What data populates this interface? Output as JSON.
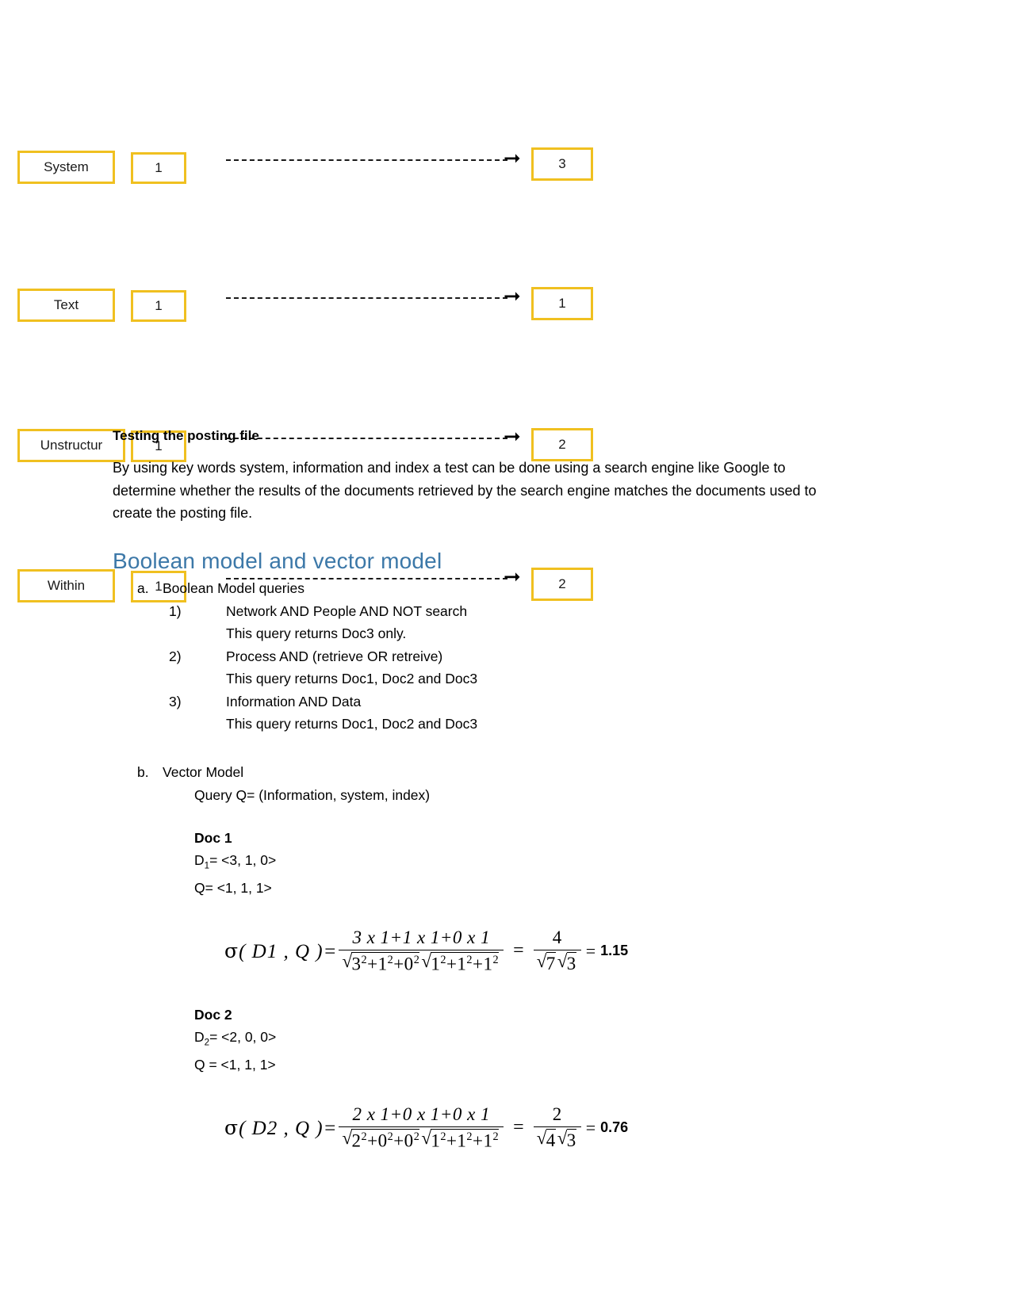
{
  "posting_diagram": {
    "rows": [
      {
        "term": "System",
        "count": "1",
        "posting": "3",
        "arrow": "dashed-arrow-right"
      },
      {
        "term": "Text",
        "count": "1",
        "posting": "1",
        "arrow": "dashed-arrow-right"
      },
      {
        "term": "Unstructur",
        "count": "1",
        "posting": "2",
        "arrow": "dashed-arrow-right"
      },
      {
        "term": "Within",
        "count": "1",
        "posting": "2",
        "arrow": "dashed-arrow-right"
      }
    ],
    "box_border_color": "#F0C020"
  },
  "testing_section": {
    "heading": "Testing the posting file",
    "paragraph": "By using key words system, information and index a test can be done using a search engine like Google to determine whether the results of the documents retrieved by the search engine matches the documents used to create the posting file."
  },
  "models_section": {
    "heading": "Boolean model and vector model",
    "heading_color": "#3C78A8",
    "boolean": {
      "marker": "a.",
      "title": "Boolean Model queries",
      "queries": [
        {
          "marker": "1)",
          "query": "Network AND People AND NOT search",
          "result": "This query returns Doc3 only."
        },
        {
          "marker": "2)",
          "query": "Process AND (retrieve OR retreive)",
          "result": "This query returns Doc1, Doc2 and Doc3"
        },
        {
          "marker": "3)",
          "query": "Information AND Data",
          "result": "This query returns Doc1, Doc2 and Doc3"
        }
      ]
    },
    "vector": {
      "marker": "b.",
      "title": "Vector  Model",
      "query_line": "Query Q= (Information, system, index)",
      "docs": [
        {
          "label": "Doc 1",
          "doc_vector_name": "D",
          "doc_vector_sub": "1",
          "doc_vector_value": "= <3, 1, 0>",
          "query_vector": "Q= <1, 1, 1>",
          "formula": {
            "lhs_sigma": "σ",
            "lhs_args": "( D1 , Q )",
            "lhs_eq": "=",
            "numerator": "3 x 1+1 x 1+0 x 1",
            "den_left_terms": "3²+1²+0²",
            "den_right_terms": "1²+1²+1²",
            "mid_eq": "=",
            "simple_num": "4",
            "simple_den_left": "7",
            "simple_den_right": "3",
            "final_eq": "=",
            "result": "1.15"
          }
        },
        {
          "label": "Doc 2",
          "doc_vector_name": "D",
          "doc_vector_sub": "2",
          "doc_vector_value": "= <2, 0, 0>",
          "query_vector": "Q = <1, 1, 1>",
          "formula": {
            "lhs_sigma": "σ",
            "lhs_args": "( D2 , Q )",
            "lhs_eq": "=",
            "numerator": "2 x 1+0 x 1+0 x 1",
            "den_left_terms": "2²+0²+0²",
            "den_right_terms": "1²+1²+1²",
            "mid_eq": "=",
            "simple_num": "2",
            "simple_den_left": "4",
            "simple_den_right": "3",
            "final_eq": "=",
            "result": "0.76"
          }
        }
      ]
    }
  }
}
